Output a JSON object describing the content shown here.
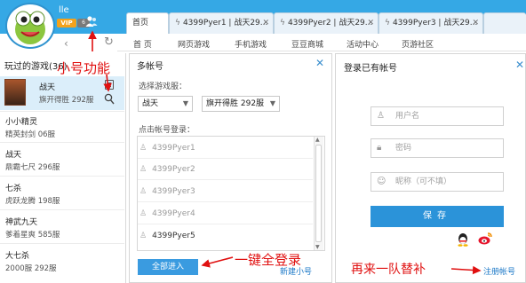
{
  "header": {
    "username": "lle",
    "vip_label": "VIP",
    "vip_level": "6"
  },
  "tabs": [
    {
      "label": "首页"
    },
    {
      "label": "4399Pyer1 | 战天29..."
    },
    {
      "label": "4399Pyer2 | 战天29..."
    },
    {
      "label": "4399Pyer3 | 战天29..."
    }
  ],
  "nav": [
    "首 页",
    "网页游戏",
    "手机游戏",
    "豆豆商城",
    "活动中心",
    "页游社区"
  ],
  "sidebar": {
    "title": "玩过的游戏(36)",
    "games": [
      {
        "name": "战天",
        "server": "旗开得胜 292服"
      },
      {
        "name": "小小精灵",
        "server": "精英封剑 06服"
      },
      {
        "name": "战天",
        "server": "鼎霸七尺 296服"
      },
      {
        "name": "七杀",
        "server": "虎跃龙腾 198服"
      },
      {
        "name": "神武九天",
        "server": "爹着星爽 585服"
      },
      {
        "name": "大七杀",
        "server": "2000服 292服"
      }
    ]
  },
  "annotations": {
    "small_account": "小号功能",
    "one_click": "一键全登录",
    "another_team": "再来一队替补"
  },
  "multi_account": {
    "title": "多帐号",
    "close": "✕",
    "select_server_label": "选择游戏服：",
    "game_select": "战天",
    "server_select": "旗开得胜 292服",
    "click_login_label": "点击帐号登录：",
    "accounts": [
      "4399Pyer1",
      "4399Pyer2",
      "4399Pyer3",
      "4399Pyer4",
      "4399Pyer5"
    ],
    "all_enter": "全部进入",
    "new_small": "新建小号"
  },
  "login_existing": {
    "title": "登录已有帐号",
    "close": "✕",
    "username_placeholder": "用户名",
    "password_placeholder": "密码",
    "nickname_placeholder": "昵称（可不填）",
    "save_button": "保存",
    "register": "注册帐号"
  }
}
